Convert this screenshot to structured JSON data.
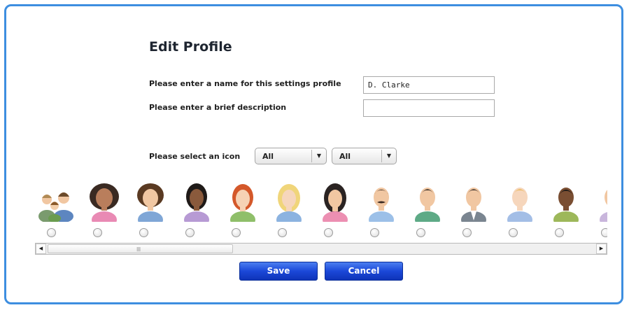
{
  "form": {
    "title": "Edit Profile",
    "name_label": "Please enter a name for this settings profile",
    "name_value": "D. Clarke",
    "description_label": "Please enter a brief description",
    "description_value": "",
    "icon_label": "Please select an icon",
    "filter1_selected": "All",
    "filter2_selected": "All"
  },
  "icons": [
    {
      "name": "group-people-icon"
    },
    {
      "name": "woman-curly-dark-hair-icon"
    },
    {
      "name": "woman-brown-hair-blue-shirt-icon"
    },
    {
      "name": "woman-dark-skin-purple-shirt-icon"
    },
    {
      "name": "woman-red-hair-icon"
    },
    {
      "name": "woman-blonde-hair-icon"
    },
    {
      "name": "woman-black-hair-pink-shirt-icon"
    },
    {
      "name": "man-mustache-icon"
    },
    {
      "name": "man-black-hair-green-shirt-icon"
    },
    {
      "name": "man-black-hair-gray-suit-icon"
    },
    {
      "name": "man-blonde-hair-icon"
    },
    {
      "name": "man-dark-skin-icon"
    },
    {
      "name": "partial-avatar-icon"
    }
  ],
  "buttons": {
    "save": "Save",
    "cancel": "Cancel"
  },
  "colors": {
    "frame_border": "#3d8ee0",
    "button_blue": "#1b48d8"
  }
}
